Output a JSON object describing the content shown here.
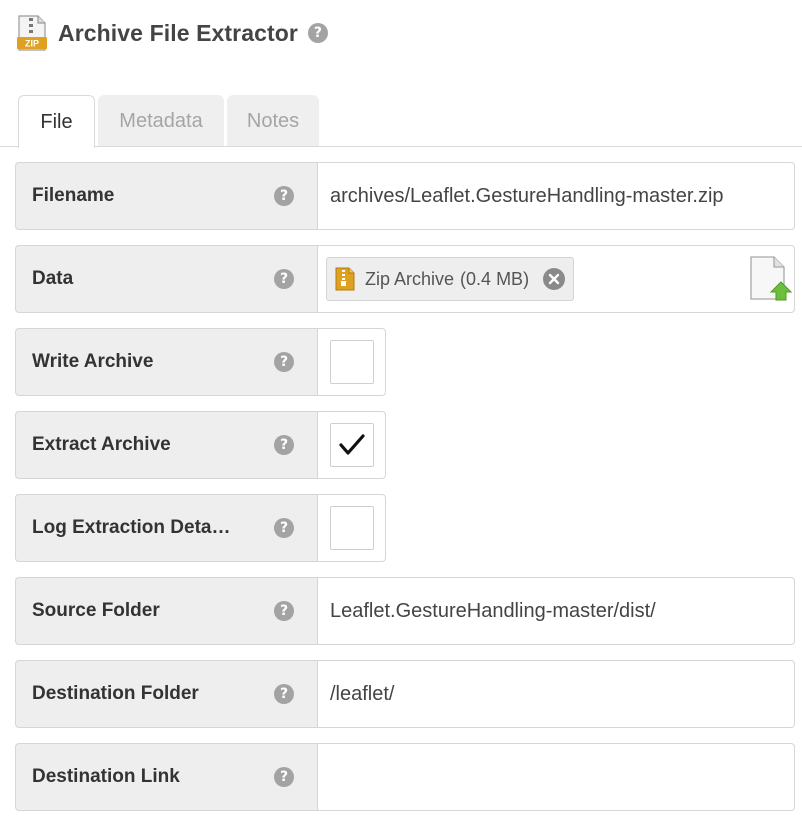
{
  "header": {
    "title": "Archive File Extractor",
    "icon": "zip-file-icon",
    "icon_text": "ZIP",
    "help": "?"
  },
  "tabs": [
    {
      "label": "File",
      "active": true
    },
    {
      "label": "Metadata",
      "active": false
    },
    {
      "label": "Notes",
      "active": false
    }
  ],
  "help_glyph": "?",
  "fields": {
    "filename": {
      "label": "Filename",
      "value": "archives/Leaflet.GestureHandling-master.zip"
    },
    "data": {
      "label": "Data",
      "file_name": "Zip Archive",
      "file_size": "(0.4 MB)",
      "file_icon": "zip-file-icon",
      "remove_icon": "remove-icon",
      "upload_icon": "upload-file-icon"
    },
    "write_archive": {
      "label": "Write Archive",
      "checked": false
    },
    "extract_archive": {
      "label": "Extract Archive",
      "checked": true
    },
    "log_extraction": {
      "label": "Log Extraction Deta…",
      "checked": false
    },
    "source_folder": {
      "label": "Source Folder",
      "value": "Leaflet.GestureHandling-master/dist/"
    },
    "destination_folder": {
      "label": "Destination Folder",
      "value": "/leaflet/"
    },
    "destination_link": {
      "label": "Destination Link",
      "value": ""
    }
  },
  "colors": {
    "zip_icon_accent": "#e0a020",
    "label_background": "#eeeeee",
    "help_icon": "#a3a3a3",
    "upload_arrow": "#6cbf3a"
  }
}
